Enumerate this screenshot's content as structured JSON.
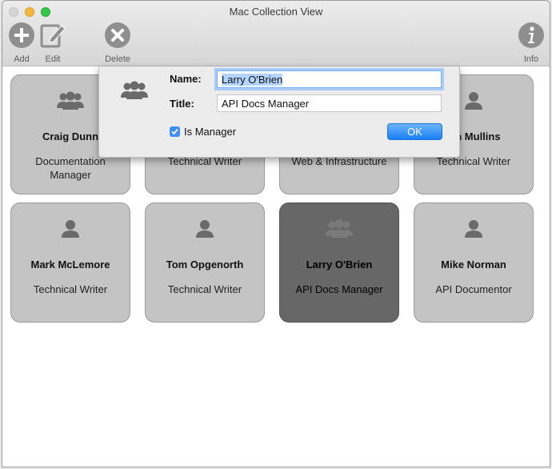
{
  "window": {
    "title": "Mac Collection View"
  },
  "toolbar": {
    "add_label": "Add",
    "edit_label": "Edit",
    "delete_label": "Delete",
    "info_label": "Info",
    "icon_color": "#8f8f8f"
  },
  "cards": [
    {
      "name": "Craig Dunn",
      "role": "Documentation Manager",
      "icon": "group-icon"
    },
    {
      "name": "",
      "role": "Technical Writer",
      "icon": "person-icon"
    },
    {
      "name": "",
      "role": "Web & Infrastructure",
      "icon": "person-icon"
    },
    {
      "name": "vin Mullins",
      "role": "Technical Writer",
      "icon": "person-icon"
    },
    {
      "name": "Mark McLemore",
      "role": "Technical Writer",
      "icon": "person-icon"
    },
    {
      "name": "Tom Opgenorth",
      "role": "Technical Writer",
      "icon": "person-icon"
    },
    {
      "name": "Larry O'Brien",
      "role": "API Docs Manager",
      "icon": "group-icon",
      "selected": true
    },
    {
      "name": "Mike Norman",
      "role": "API Documentor",
      "icon": "person-icon"
    }
  ],
  "popover": {
    "name_label": "Name:",
    "name_value": "Larry O'Brien",
    "title_label": "Title:",
    "title_value": "API Docs Manager",
    "manager_label": "Is Manager",
    "manager_checked": true,
    "ok_label": "OK",
    "accent": "#1a7ff5"
  }
}
